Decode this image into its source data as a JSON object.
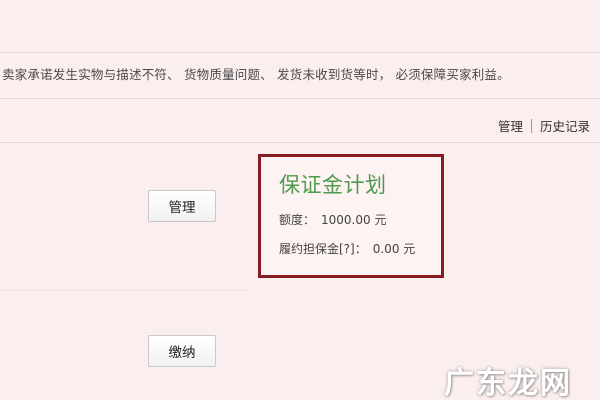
{
  "notice": "卖家承诺发生实物与描述不符、 货物质量问题、 发货未收到货等时， 必须保障买家利益。",
  "links": {
    "manage": "管理",
    "history": "历史记录"
  },
  "buttons": {
    "manage": "管理",
    "pay": "缴纳"
  },
  "plan": {
    "logo": "保证金计划",
    "quota_label": "额度：",
    "quota_value": "1000.00 元",
    "deposit_label": "履约担保金[?]：",
    "deposit_value": "0.00 元"
  },
  "watermark": "广东龙网",
  "colors": {
    "panel_border": "#8a1b22",
    "logo_green": "#4f9a4d",
    "background": "#fbeeee"
  }
}
